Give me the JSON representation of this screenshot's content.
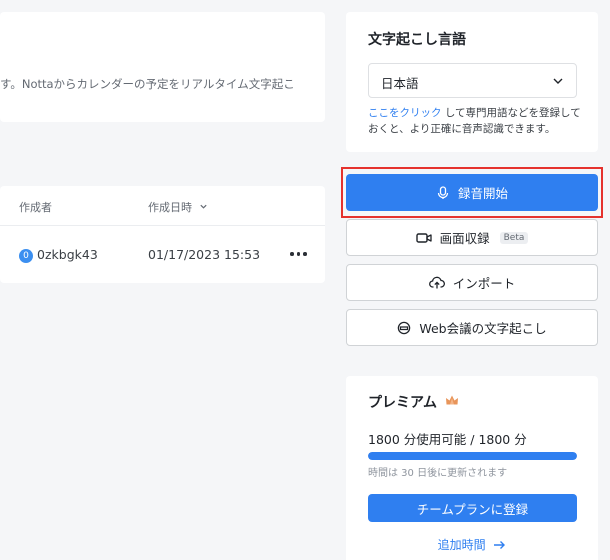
{
  "banner": {
    "text": "す。Nottaからカレンダーの予定をリアルタイム文字起こ"
  },
  "table": {
    "col_owner": "作成者",
    "col_created": "作成日時",
    "rows": [
      {
        "owner_badge": "0",
        "owner": "0zkbgk43",
        "created": "01/17/2023 15:53"
      }
    ]
  },
  "language": {
    "title": "文字起こし言語",
    "selected": "日本語",
    "hint_link": "ここをクリック",
    "hint_text": "して専門用語などを登録しておくと、より正確に音声認識できます。"
  },
  "actions": {
    "record": "録音開始",
    "screen": "画面収録",
    "screen_badge": "Beta",
    "import": "インポート",
    "web": "Web会議の文字起こし"
  },
  "premium": {
    "title": "プレミアム",
    "usage": "1800 分使用可能 / 1800 分",
    "usage_fraction": 1.0,
    "note": "時間は 30 日後に更新されます",
    "cta": "チームプランに登録",
    "more": "追加時間"
  },
  "colors": {
    "accent": "#2f7ff0",
    "highlight": "#e5322d"
  }
}
